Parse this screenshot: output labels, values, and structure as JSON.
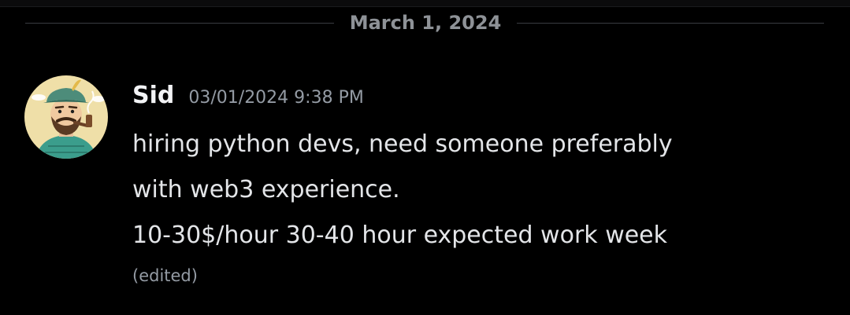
{
  "date_divider": {
    "label": "March 1, 2024"
  },
  "message": {
    "author": "Sid",
    "timestamp": "03/01/2024 9:38 PM",
    "avatar_icon": "avatar-man-with-pipe-icon",
    "lines": [
      "hiring python devs, need someone preferably",
      "with web3 experience.",
      "10-30$/hour 30-40 hour expected work week"
    ],
    "edited_label": "(edited)"
  },
  "colors": {
    "background": "#000000",
    "author": "#f2f3f5",
    "body_text": "#e3e5e8",
    "muted": "#949ba4",
    "divider": "#3a3c42"
  }
}
